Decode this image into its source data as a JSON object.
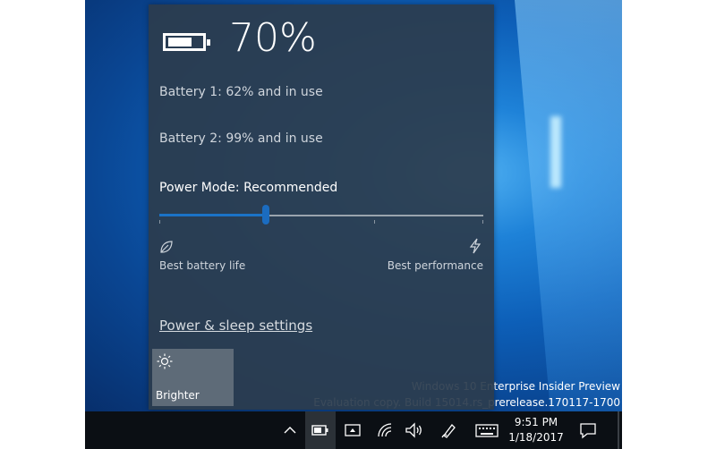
{
  "flyout": {
    "battery_percent": "70%",
    "battery1": "Battery 1: 62% and in use",
    "battery2": "Battery 2: 99% and in use",
    "power_mode": "Power Mode: Recommended",
    "slider_value": 0.33,
    "left_label": "Best battery life",
    "right_label": "Best performance",
    "settings_link": "Power & sleep settings",
    "quick_action": {
      "label": "Brighter",
      "icon": "sun-icon"
    }
  },
  "watermark": {
    "line1": "Windows 10 Enterprise Insider Preview",
    "line2": "Evaluation copy. Build 15014.rs_prerelease.170117-1700"
  },
  "taskbar": {
    "time": "9:51 PM",
    "date": "1/18/2017",
    "icons": [
      "chevron-up-icon",
      "battery-icon",
      "tablet-mode-icon",
      "wifi-icon",
      "volume-icon",
      "pen-icon",
      "keyboard-icon",
      "action-center-icon"
    ]
  },
  "colors": {
    "accent": "#1b73c7",
    "flyout_bg": "#2c3c4e",
    "taskbar_bg": "#0b0f14"
  }
}
